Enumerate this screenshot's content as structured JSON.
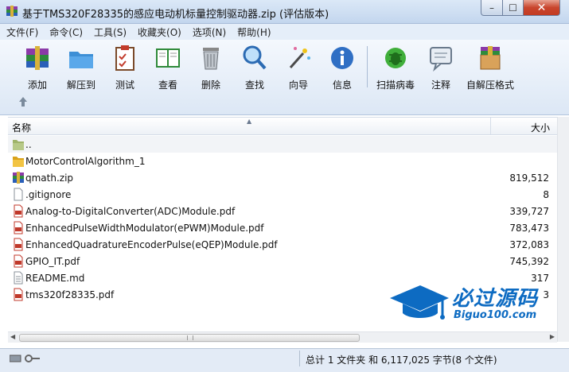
{
  "window": {
    "title": "基于TMS320F28335的感应电动机标量控制驱动器.zip (评估版本)",
    "icon": "winrar-icon",
    "controls": {
      "minimize": "–",
      "maximize": "☐",
      "close": "✕"
    }
  },
  "menu": [
    {
      "label": "文件(F)"
    },
    {
      "label": "命令(C)"
    },
    {
      "label": "工具(S)"
    },
    {
      "label": "收藏夹(O)"
    },
    {
      "label": "选项(N)"
    },
    {
      "label": "帮助(H)"
    }
  ],
  "toolbar": [
    {
      "label": "添加",
      "icon": "add-archive-icon"
    },
    {
      "label": "解压到",
      "icon": "extract-folder-icon"
    },
    {
      "label": "测试",
      "icon": "test-clipboard-icon"
    },
    {
      "label": "查看",
      "icon": "view-book-icon"
    },
    {
      "label": "删除",
      "icon": "delete-trash-icon"
    },
    {
      "label": "查找",
      "icon": "find-magnifier-icon"
    },
    {
      "label": "向导",
      "icon": "wizard-wand-icon"
    },
    {
      "label": "信息",
      "icon": "info-icon"
    },
    {
      "label": "扫描病毒",
      "icon": "virus-scan-icon"
    },
    {
      "label": "注释",
      "icon": "comment-icon"
    },
    {
      "label": "自解压格式",
      "icon": "sfx-box-icon"
    }
  ],
  "list": {
    "columns": {
      "name": "名称",
      "size": "大小"
    },
    "rows": [
      {
        "name": "..",
        "size": "",
        "icon": "parent-folder-icon"
      },
      {
        "name": "MotorControlAlgorithm_1",
        "size": "",
        "icon": "folder-icon"
      },
      {
        "name": "qmath.zip",
        "size": "819,512",
        "icon": "archive-icon"
      },
      {
        "name": ".gitignore",
        "size": "8",
        "icon": "file-icon"
      },
      {
        "name": "Analog-to-DigitalConverter(ADC)Module.pdf",
        "size": "339,727",
        "icon": "pdf-icon"
      },
      {
        "name": "EnhancedPulseWidthModulator(ePWM)Module.pdf",
        "size": "783,473",
        "icon": "pdf-icon"
      },
      {
        "name": "EnhancedQuadratureEncoderPulse(eQEP)Module.pdf",
        "size": "372,083",
        "icon": "pdf-icon"
      },
      {
        "name": "GPIO_IT.pdf",
        "size": "745,392",
        "icon": "pdf-icon"
      },
      {
        "name": "README.md",
        "size": "317",
        "icon": "text-file-icon"
      },
      {
        "name": "tms320f28335.pdf",
        "size": "3",
        "icon": "pdf-icon"
      }
    ]
  },
  "status": {
    "text": "总计 1 文件夹 和 6,117,025 字节(8 个文件)"
  },
  "watermark": {
    "cn": "必过源码",
    "en": "Biguo100.com"
  },
  "colors": {
    "titlebar": "#c3d6ee",
    "menubar": "#e5eef9",
    "watermark": "#0d6bc2",
    "close": "#c9452d"
  }
}
